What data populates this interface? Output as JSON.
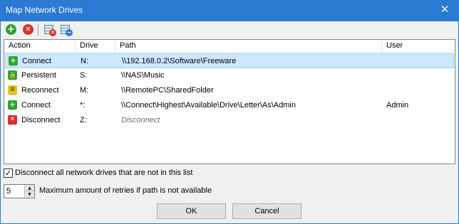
{
  "window": {
    "title": "Map Network Drives",
    "close_glyph": "✕"
  },
  "toolbar": {
    "add": {
      "icon": "add-icon",
      "glyph": "+"
    },
    "remove": {
      "icon": "remove-icon",
      "glyph": "✕"
    },
    "clear_all": {
      "icon": "clear-list-icon",
      "glyph": "✕"
    },
    "remove_entry": {
      "icon": "remove-list-entry-icon",
      "glyph": "−"
    }
  },
  "list": {
    "columns": {
      "action": "Action",
      "drive": "Drive",
      "path": "Path",
      "user": "User"
    },
    "rows": [
      {
        "action": "Connect",
        "icon": "connect-icon",
        "glyph": "+",
        "drive": "N:",
        "path": "\\\\192.168.0.2\\Software\\Freeware",
        "user": "",
        "selected": true
      },
      {
        "action": "Persistent",
        "icon": "persistent-lock-icon",
        "glyph": "🔒",
        "drive": "S:",
        "path": "\\\\NAS\\Music",
        "user": "",
        "selected": false
      },
      {
        "action": "Reconnect",
        "icon": "reconnect-icon",
        "glyph": "≡",
        "drive": "M:",
        "path": "\\\\RemotePC\\SharedFolder",
        "user": "",
        "selected": false
      },
      {
        "action": "Connect",
        "icon": "connect-icon",
        "glyph": "+",
        "drive": "*:",
        "path": "\\\\Connect\\Highest\\Available\\Drive\\Letter\\As\\Admin",
        "user": "Admin",
        "selected": false
      },
      {
        "action": "Disconnect",
        "icon": "disconnect-icon",
        "glyph": "✕",
        "drive": "Z:",
        "path": "Disconnect",
        "user": "",
        "selected": false
      }
    ]
  },
  "options": {
    "disconnect_all_label": "Disconnect all network drives that are not in this list",
    "disconnect_all_checked": true,
    "check_glyph": "✓",
    "retries_value": "5",
    "retries_label": "Maximum amount of retries if path is not available",
    "spin_up_glyph": "▲",
    "spin_down_glyph": "▼"
  },
  "buttons": {
    "ok": "OK",
    "cancel": "Cancel"
  }
}
